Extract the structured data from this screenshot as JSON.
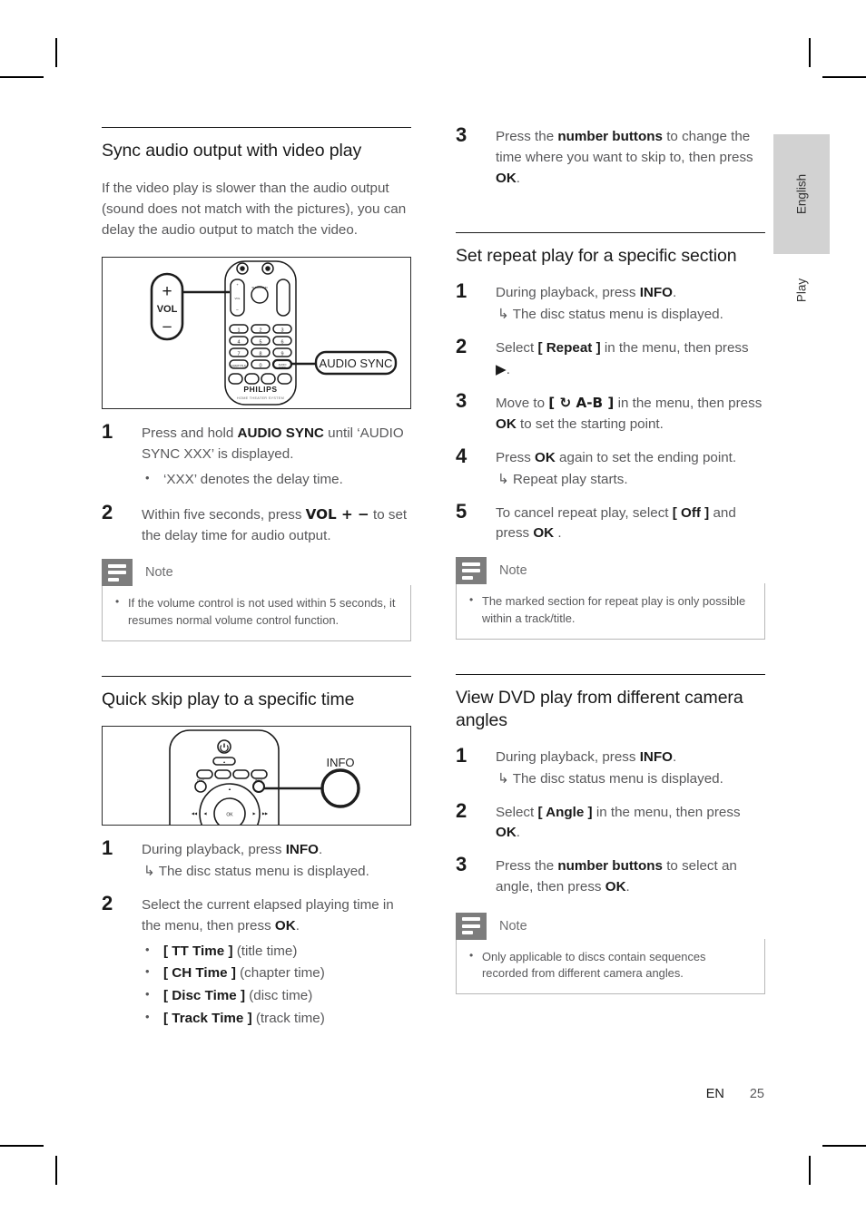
{
  "page": {
    "language_tab": "English",
    "chapter_tab": "Play",
    "footer_language": "EN",
    "footer_page_number": "25"
  },
  "left_column": {
    "sections": [
      {
        "title": "Sync audio output with video play",
        "intro": "If the video play is slower than the audio output (sound does not match with the pictures), you can delay the audio output to match the video.",
        "figure": {
          "name": "remote-audio-sync-diagram",
          "callout_label": "AUDIO SYNC",
          "brand": "PHILIPS",
          "brand_sub": "HOME THEATER SYSTEM",
          "vol_label": "VOL",
          "vol_plus": "+",
          "vol_minus": "−",
          "keys": [
            "1",
            "2",
            "3",
            "4",
            "5",
            "6",
            "7",
            "8",
            "9",
            "0"
          ],
          "key_extra_left": "SUBTITLE",
          "key_extra_right": "AUDIO SYNC"
        },
        "steps": [
          {
            "num": "1",
            "pre": "Press and hold ",
            "bold": "AUDIO SYNC",
            "post": " until ‘AUDIO SYNC XXX’ is displayed.",
            "bullets": [
              "‘XXX’ denotes the delay time."
            ]
          },
          {
            "num": "2",
            "pre": "Within five seconds, press ",
            "bold": "VOL + −",
            "post": " to set the delay time for audio output."
          }
        ],
        "note": {
          "label": "Note",
          "items": [
            "If the volume control is not used within 5 seconds, it resumes normal volume control function."
          ]
        }
      },
      {
        "title": "Quick skip play to a specific time",
        "figure": {
          "name": "remote-info-diagram",
          "callout_label": "INFO"
        },
        "steps": [
          {
            "num": "1",
            "pre": "During playback, press ",
            "bold": "INFO",
            "post": ".",
            "arrow": "The disc status menu is displayed."
          },
          {
            "num": "2",
            "pre": "Select the current elapsed playing time in the menu, then press ",
            "bold": "OK",
            "post": ".",
            "bullets_rich": [
              {
                "bold": "[ TT Time ]",
                "plain": " (title time)"
              },
              {
                "bold": "[ CH Time ]",
                "plain": " (chapter time)"
              },
              {
                "bold": "[ Disc Time ]",
                "plain": " (disc time)"
              },
              {
                "bold": "[ Track Time ]",
                "plain": " (track time)"
              }
            ]
          }
        ]
      }
    ]
  },
  "right_column": {
    "continued_step": {
      "num": "3",
      "pre": "Press the ",
      "bold": "number buttons",
      "mid": " to change the time where you want to skip to, then press ",
      "bold2": "OK",
      "post": "."
    },
    "sections": [
      {
        "title": "Set repeat play for a specific section",
        "steps": [
          {
            "num": "1",
            "pre": "During playback, press ",
            "bold": "INFO",
            "post": ".",
            "arrow": "The disc status menu is displayed."
          },
          {
            "num": "2",
            "pre": "Select ",
            "bold": "[ Repeat ]",
            "mid": " in the menu, then press ",
            "bold2": "▶",
            "post": "."
          },
          {
            "num": "3",
            "pre": "Move to ",
            "bold": "[ ↻ A-B ]",
            "mid": " in the menu, then press ",
            "bold2": "OK",
            "post": " to set the starting point."
          },
          {
            "num": "4",
            "pre": "Press ",
            "bold": "OK",
            "post": " again to set the ending point.",
            "arrow": "Repeat play starts."
          },
          {
            "num": "5",
            "pre": "To cancel repeat play, select ",
            "bold": "[ Off ]",
            "mid": " and press ",
            "bold2": "OK",
            "post": " ."
          }
        ],
        "note": {
          "label": "Note",
          "items": [
            "The marked section for repeat play is only possible within a track/title."
          ]
        }
      },
      {
        "title": "View DVD play from different camera angles",
        "steps": [
          {
            "num": "1",
            "pre": "During playback, press ",
            "bold": "INFO",
            "post": ".",
            "arrow": "The disc status menu is displayed."
          },
          {
            "num": "2",
            "pre": "Select ",
            "bold": "[ Angle ]",
            "mid": " in the menu, then press ",
            "bold2": "OK",
            "post": "."
          },
          {
            "num": "3",
            "pre": "Press the ",
            "bold": "number buttons",
            "mid": " to select an angle, then press ",
            "bold2": "OK",
            "post": "."
          }
        ],
        "note": {
          "label": "Note",
          "items": [
            "Only applicable to discs contain sequences recorded from different camera angles."
          ]
        }
      }
    ]
  }
}
